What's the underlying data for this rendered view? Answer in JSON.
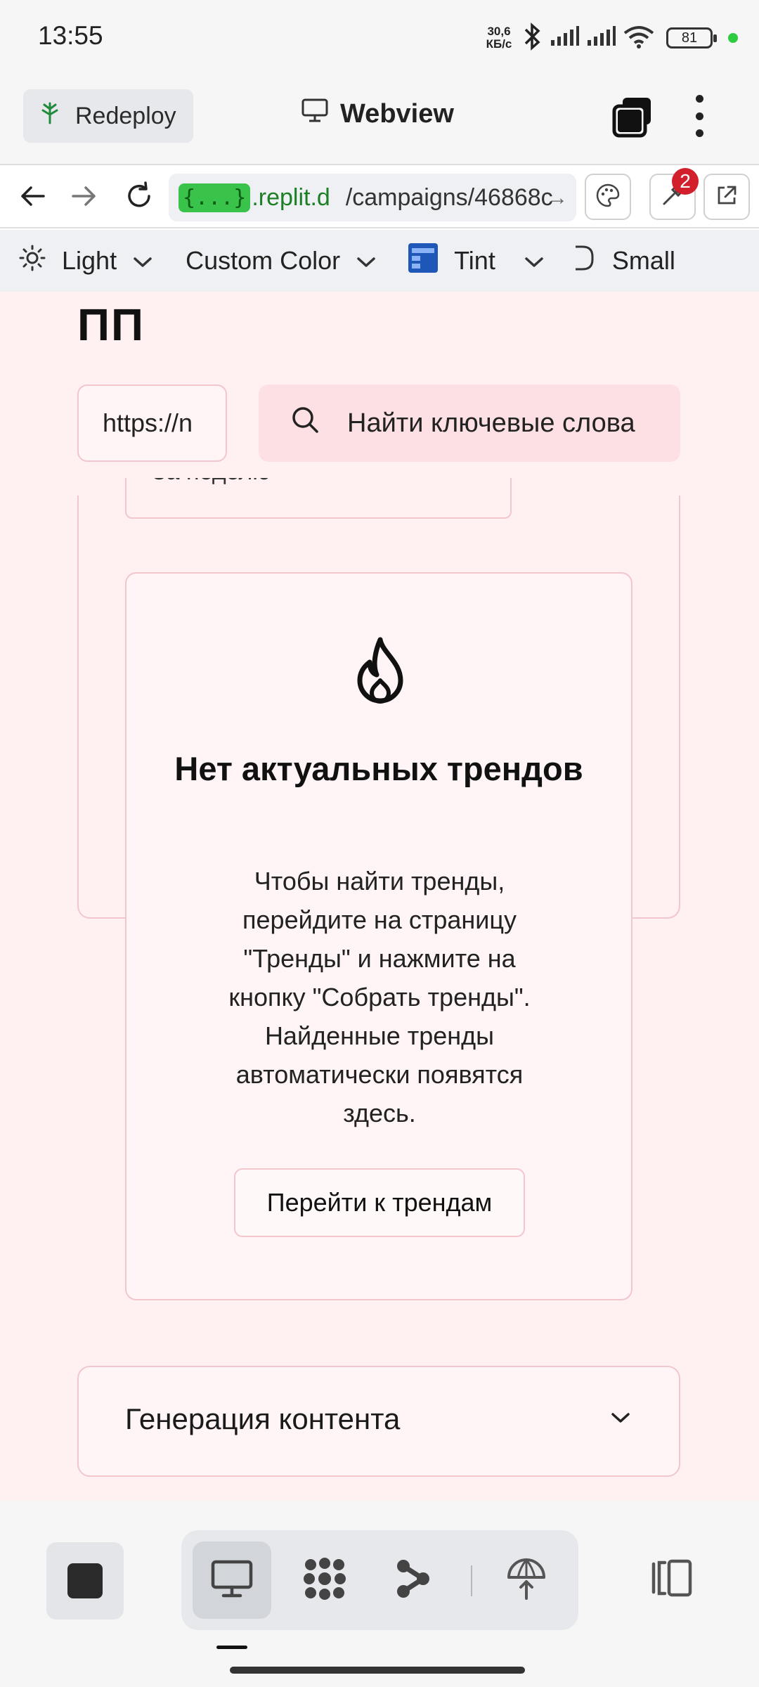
{
  "status_bar": {
    "time": "13:55",
    "net_speed_value": "30,6",
    "net_speed_unit": "КБ/с",
    "battery": "81"
  },
  "app_bar": {
    "redeploy_label": "Redeploy",
    "title": "Webview"
  },
  "url_bar": {
    "badge": "{...}",
    "host": ".replit.d",
    "path": "/campaigns/46868c",
    "notification_count": "2"
  },
  "theme_bar": {
    "mode": "Light",
    "color": "Custom Color",
    "tint": "Tint",
    "size": "Small"
  },
  "page": {
    "heading": "ПП",
    "url_input_value": "https://n",
    "search_button": "Найти ключевые слова",
    "peek_card_text": "За неделю",
    "empty_state": {
      "title": "Нет актуальных трендов",
      "description": "Чтобы найти тренды, перейдите на страницу \"Тренды\" и нажмите на кнопку \"Собрать тренды\". Найденные тренды автоматически появятся здесь.",
      "button": "Перейти к трендам"
    },
    "content_generation": {
      "title": "Генерация контента"
    }
  },
  "colors": {
    "accent_green": "#3ac34a",
    "page_background": "#fff0f2",
    "card_border": "#f2c6cd",
    "search_button_bg": "#fde0e4",
    "notification_red": "#d31f2b"
  },
  "icons": {
    "redeploy": "tree-icon",
    "webview": "monitor-icon",
    "empty_state": "flame-icon",
    "search": "search-icon",
    "tint": "palette-swatch-icon"
  }
}
